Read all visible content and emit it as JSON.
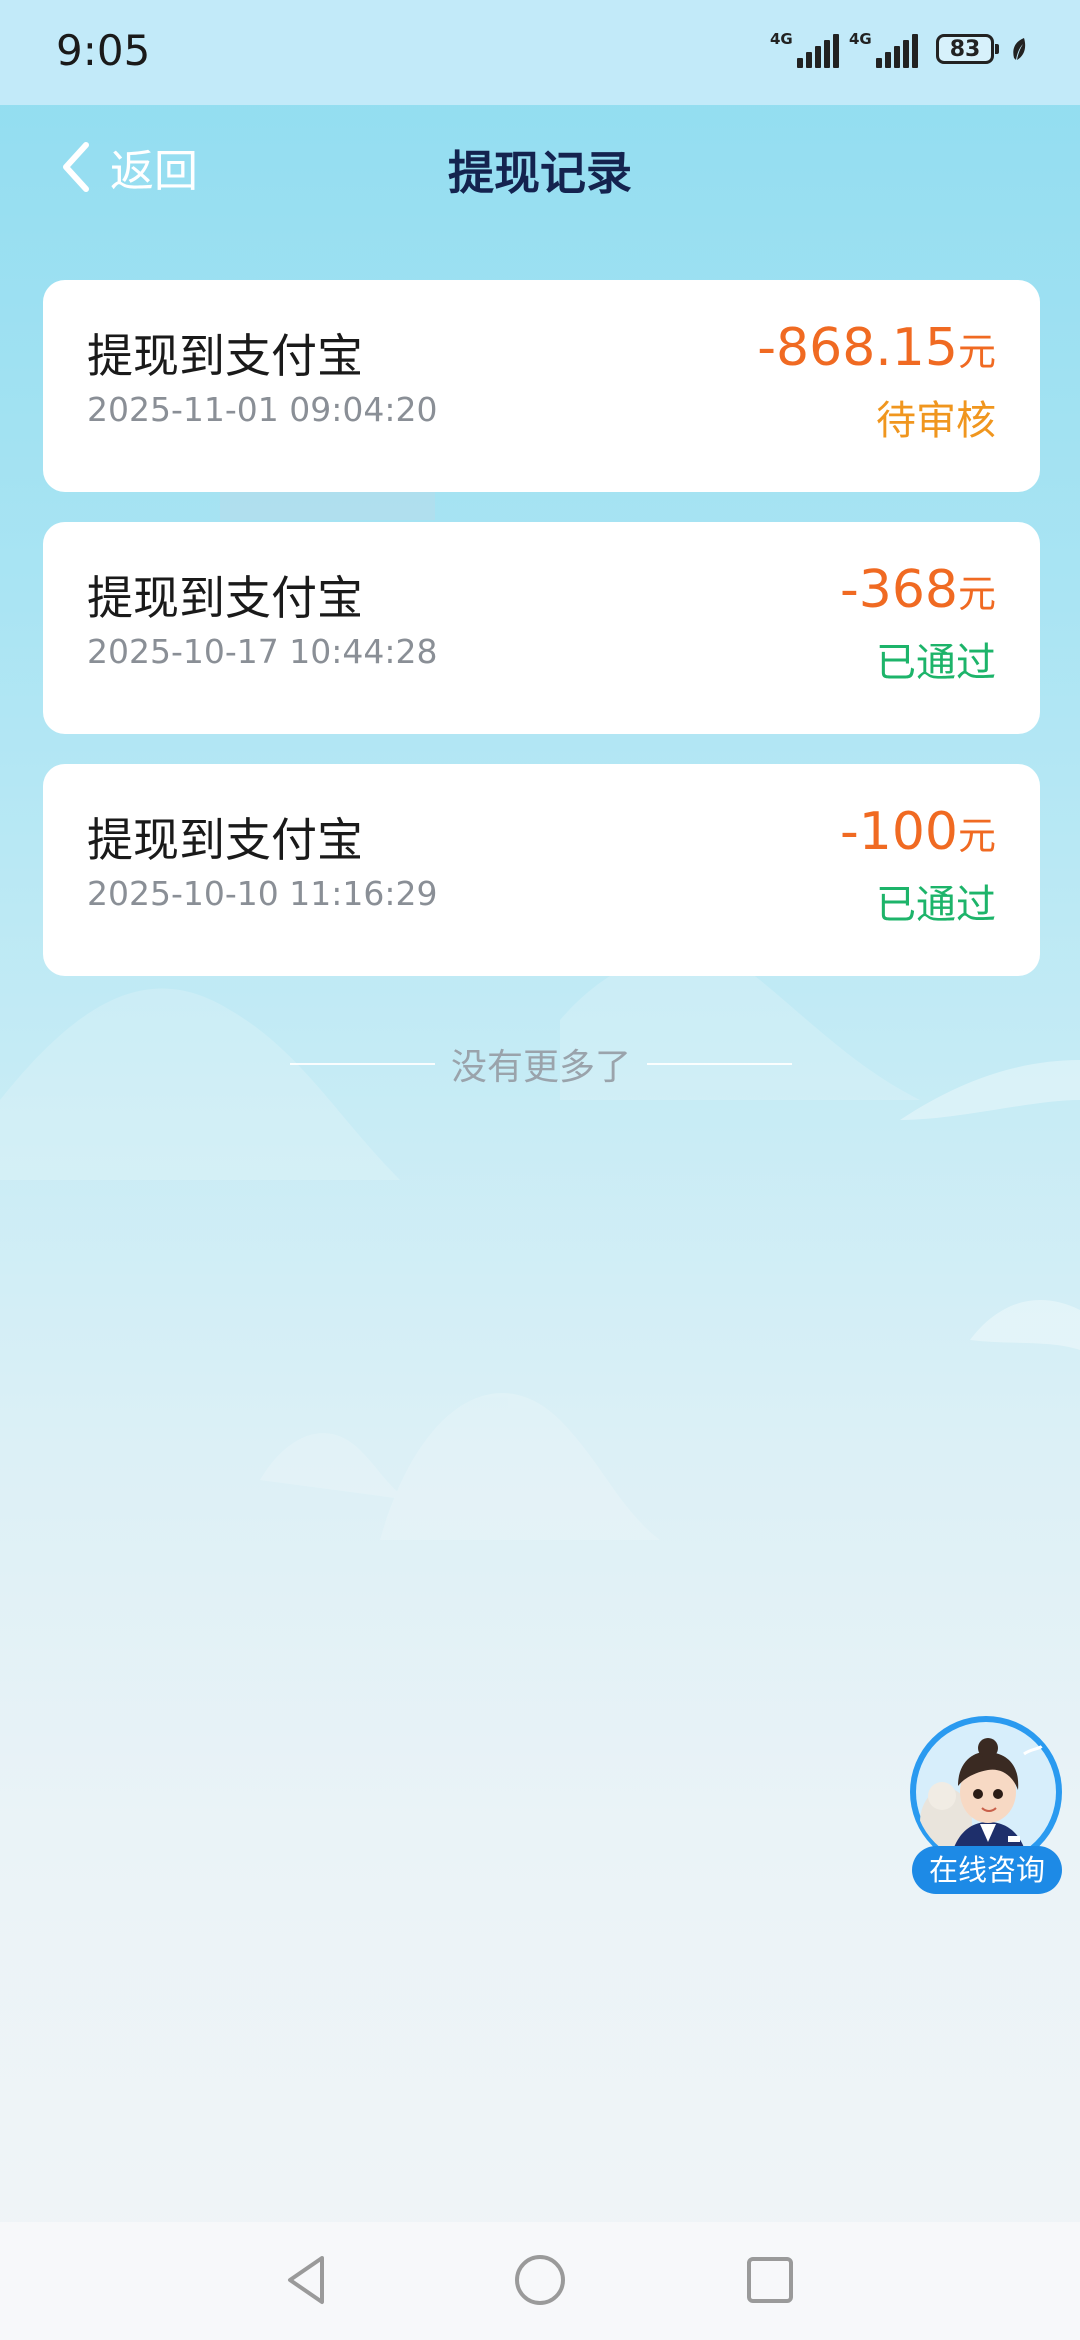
{
  "status_bar": {
    "time": "9:05",
    "network_1": "4G",
    "network_2": "4G",
    "battery": "83"
  },
  "header": {
    "back_label": "返回",
    "title": "提现记录"
  },
  "records": [
    {
      "title": "提现到支付宝",
      "time": "2025-11-01 09:04:20",
      "amount": "-868.15",
      "unit": "元",
      "status": "待审核",
      "status_color": "#f0961e"
    },
    {
      "title": "提现到支付宝",
      "time": "2025-10-17 10:44:28",
      "amount": "-368",
      "unit": "元",
      "status": "已通过",
      "status_color": "#1db46a"
    },
    {
      "title": "提现到支付宝",
      "time": "2025-10-10 11:16:29",
      "amount": "-100",
      "unit": "元",
      "status": "已通过",
      "status_color": "#1db46a"
    }
  ],
  "end_text": "没有更多了",
  "consult": {
    "label": "在线咨询"
  },
  "nav": {
    "back": "back-triangle-icon",
    "home": "home-circle-icon",
    "recents": "recents-square-icon"
  },
  "colors": {
    "amount": "#f06a22",
    "title": "#14234f",
    "consult_bg": "#1d8ae6"
  }
}
